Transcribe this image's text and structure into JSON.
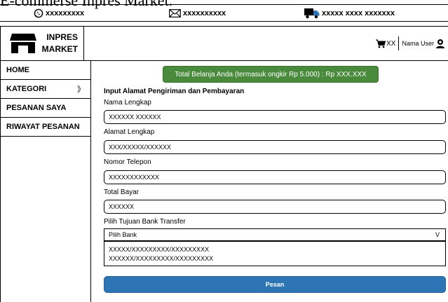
{
  "caption": "E-commerse Inpres Market.",
  "topbar": {
    "phone": "xxxxxxxxx",
    "email": "xxxxxxxxxx",
    "address": "xxxxx xxxx  xxxxxxx"
  },
  "header": {
    "logo_line1": "INPRES",
    "logo_line2": "MARKET",
    "cart_count": "XX",
    "username": "Nama User"
  },
  "sidebar": {
    "items": [
      {
        "label": "HOME"
      },
      {
        "label": "KATEGORI",
        "chevron": "》"
      },
      {
        "label": "PESANAN SAYA"
      },
      {
        "label": "RIWAYAT PESANAN"
      }
    ]
  },
  "main": {
    "total_banner": "Total Belanja Anda (termasuk ongkir Rp 5.000) : Rp XXX.XXX",
    "form_title": "Input Alamat Pengiriman dan Pembayaran",
    "fields": [
      {
        "label": "Nama Lengkap",
        "value": "XXXXXX XXXXXX"
      },
      {
        "label": "Alamat Lengkap",
        "value": "XXX/XXXXX/XXXXXX"
      },
      {
        "label": "Nomor Telepon",
        "value": "XXXXXXXXXXXX"
      },
      {
        "label": "Total Bayar",
        "value": "XXXXXX"
      }
    ],
    "bank_label": "Pilih Tujuan Bank Transfer",
    "bank_select": "Pilih Bank",
    "bank_caret": "V",
    "bank_options": [
      "XXXXX/XXXXXXXXX/XXXXXXXXX",
      "XXXXXX/XXXXXXXXX/XXXXXXXXX"
    ],
    "submit_label": "Pesan"
  },
  "colors": {
    "banner_green": "#4a8a3c",
    "button_blue": "#2e75b6"
  }
}
